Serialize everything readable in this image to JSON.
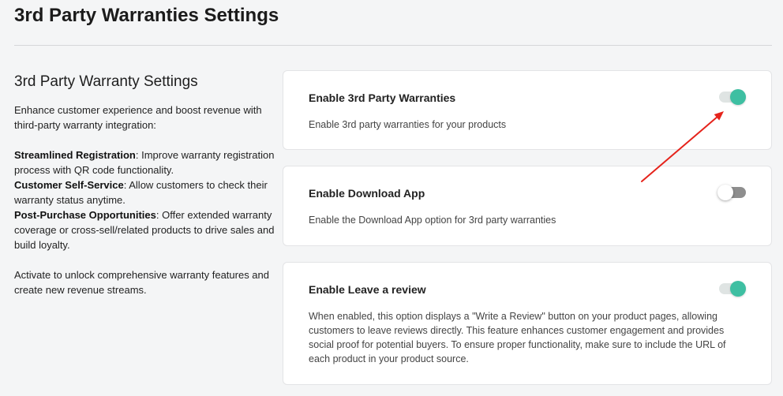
{
  "page": {
    "title": "3rd Party Warranties Settings"
  },
  "intro": {
    "heading": "3rd Party Warranty Settings",
    "lead": "Enhance customer experience and boost revenue with third-party warranty integration:",
    "features": [
      {
        "label": "Streamlined Registration",
        "text": ": Improve warranty registration process with QR code functionality."
      },
      {
        "label": "Customer Self-Service",
        "text": ": Allow customers to check their warranty status anytime."
      },
      {
        "label": "Post-Purchase Opportunities",
        "text": ": Offer extended warranty coverage or cross-sell/related products to drive sales and build loyalty."
      }
    ],
    "closing": "Activate to unlock comprehensive warranty features and create new revenue streams."
  },
  "settings": [
    {
      "title": "Enable 3rd Party Warranties",
      "description": "Enable 3rd party warranties for your products",
      "enabled": true
    },
    {
      "title": "Enable Download App",
      "description": "Enable the Download App option for 3rd party warranties",
      "enabled": false
    },
    {
      "title": "Enable Leave a review",
      "description": "When enabled, this option displays a \"Write a Review\" button on your product pages, allowing customers to leave reviews directly. This feature enhances customer engagement and provides social proof for potential buyers. To ensure proper functionality, make sure to include the URL of each product in your product source.",
      "enabled": true
    }
  ],
  "theme": {
    "background": "#f4f5f6",
    "card_background": "#ffffff",
    "accent": "#3ebfa2",
    "annotation_color": "#e5231b"
  }
}
